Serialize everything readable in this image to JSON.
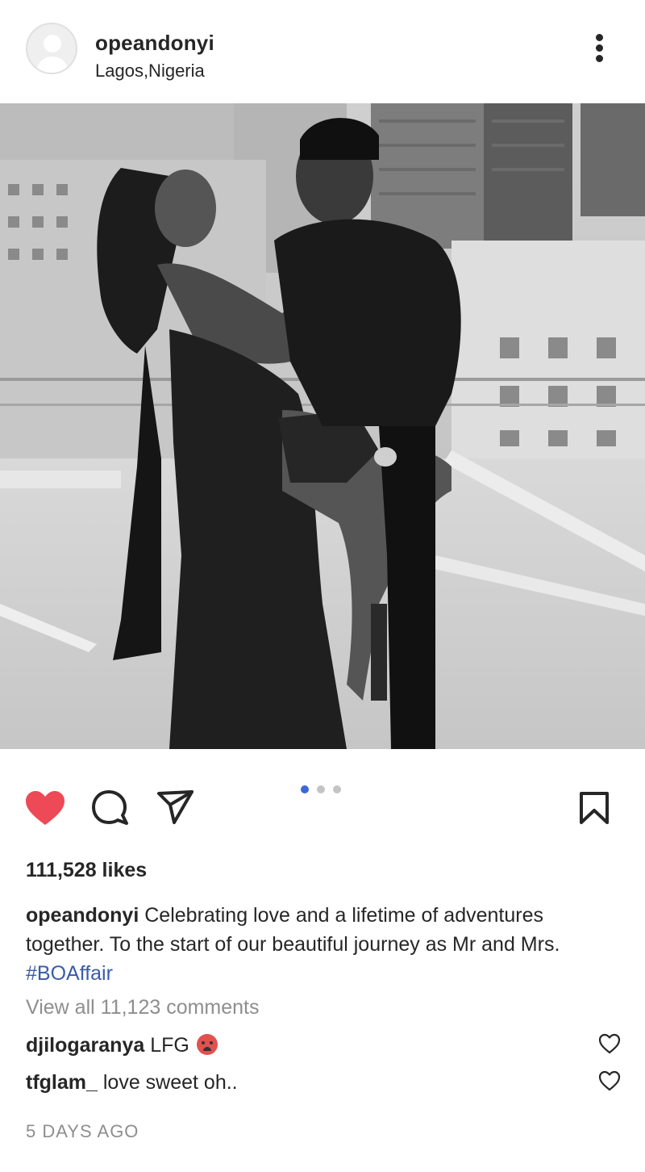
{
  "post": {
    "username": "opeandonyi",
    "location": "Lagos,Nigeria",
    "likes": "111,528 likes",
    "caption_user": "opeandonyi",
    "caption_text": "Celebrating love and a lifetime of adventures together. To the start of our beautiful journey as Mr and Mrs.",
    "hashtag": "#BOAffair",
    "view_all": "View all 11,123 comments",
    "timestamp": "5 DAYS AGO",
    "carousel": {
      "count": 3,
      "active_index": 0
    }
  },
  "comments": [
    {
      "user": "djilogaranya",
      "text": "LFG",
      "emoji": "flushed-face-emoji"
    },
    {
      "user": "tfglam_",
      "text": "love sweet oh.."
    }
  ],
  "icons": {
    "more": "more-vertical-icon",
    "like": "heart-filled-icon",
    "comment": "comment-bubble-icon",
    "share": "paper-plane-icon",
    "save": "bookmark-icon",
    "comment_like": "heart-outline-icon"
  },
  "colors": {
    "like_active": "#ed4956",
    "hashtag": "#3a5ca8",
    "carousel_active": "#3d67d6",
    "secondary_text": "#8e8e8e"
  }
}
